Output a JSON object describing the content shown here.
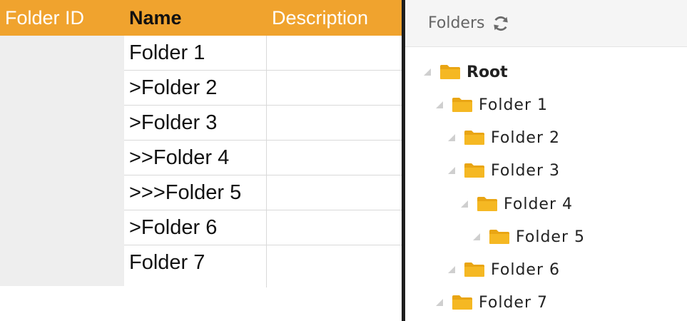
{
  "sheet": {
    "headers": {
      "folder_id": "Folder ID",
      "name": "Name",
      "description": "Description"
    },
    "rows": [
      {
        "name": ">Folder 1",
        "display": "Folder 1",
        "description": ""
      },
      {
        "display": ">Folder 2",
        "description": ""
      },
      {
        "display": ">Folder 3",
        "description": ""
      },
      {
        "display": ">>Folder 4",
        "description": ""
      },
      {
        "display": ">>>Folder 5",
        "description": ""
      },
      {
        "display": ">Folder 6",
        "description": ""
      },
      {
        "display": "Folder 7",
        "description": ""
      }
    ],
    "colors": {
      "header_bg": "#f0a32e",
      "id_col_bg": "#eeeeee"
    }
  },
  "tree_panel": {
    "title": "Folders",
    "refresh_icon": "refresh-icon",
    "nodes": [
      {
        "label": "Root",
        "depth": 0,
        "expanded": true
      },
      {
        "label": "Folder 1",
        "depth": 1,
        "expanded": true
      },
      {
        "label": "Folder 2",
        "depth": 2,
        "expanded": true
      },
      {
        "label": "Folder 3",
        "depth": 2,
        "expanded": true
      },
      {
        "label": "Folder 4",
        "depth": 3,
        "expanded": true
      },
      {
        "label": "Folder 5",
        "depth": 4,
        "expanded": true
      },
      {
        "label": "Folder 6",
        "depth": 2,
        "expanded": true
      },
      {
        "label": "Folder 7",
        "depth": 1,
        "expanded": true
      }
    ],
    "colors": {
      "folder": "#f5b823",
      "folder_dark": "#e9a514"
    }
  }
}
